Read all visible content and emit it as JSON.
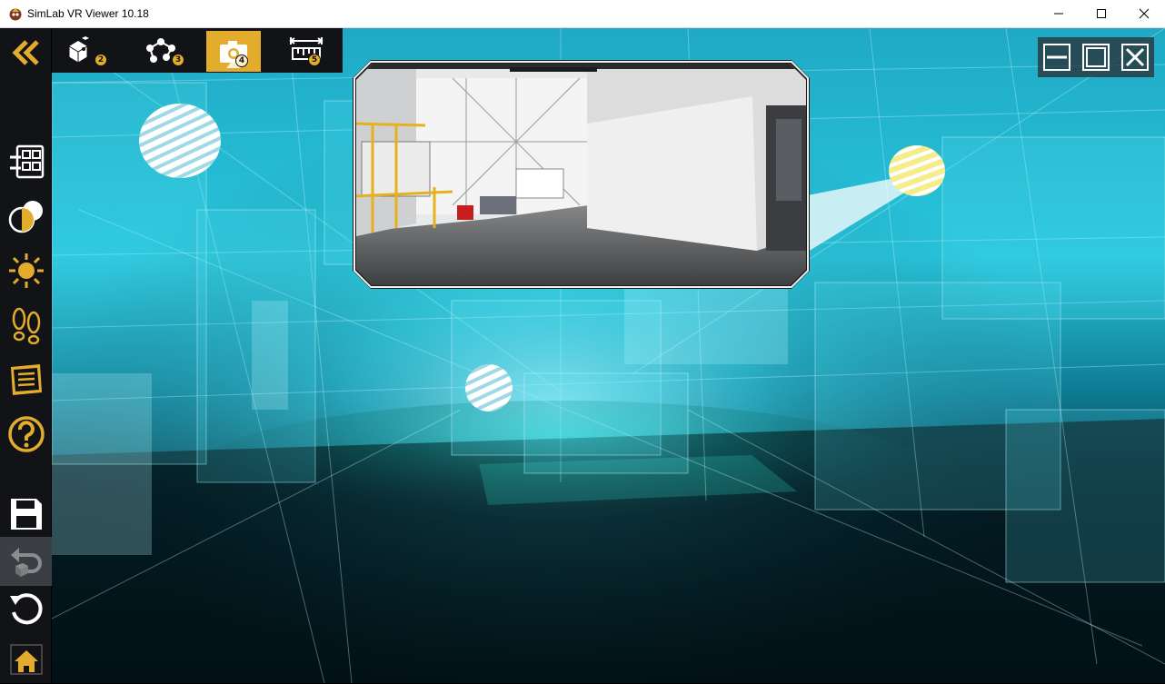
{
  "window": {
    "title": "SimLab VR Viewer 10.18"
  },
  "colors": {
    "accent": "#e3ac2c",
    "toolbar_bg": "#111316",
    "scene_cyan": "#2fd8f0",
    "sphere_yellow": "#f6ec8a"
  },
  "top_tabs": [
    {
      "icon": "objects-cube-icon",
      "badge": "2",
      "active": false
    },
    {
      "icon": "nodes-network-icon",
      "badge": "3",
      "active": false
    },
    {
      "icon": "camera-icon",
      "badge": "4",
      "active": true
    },
    {
      "icon": "measure-ruler-icon",
      "badge": "5",
      "active": false
    }
  ],
  "left_toolbar": [
    "collapse-chevrons-icon",
    "scene-tree-icon",
    "materials-icon",
    "lighting-sun-icon",
    "walk-footprints-icon",
    "notes-icon",
    "help-icon",
    "save-icon",
    "undo-icon",
    "reset-icon",
    "home-icon"
  ]
}
